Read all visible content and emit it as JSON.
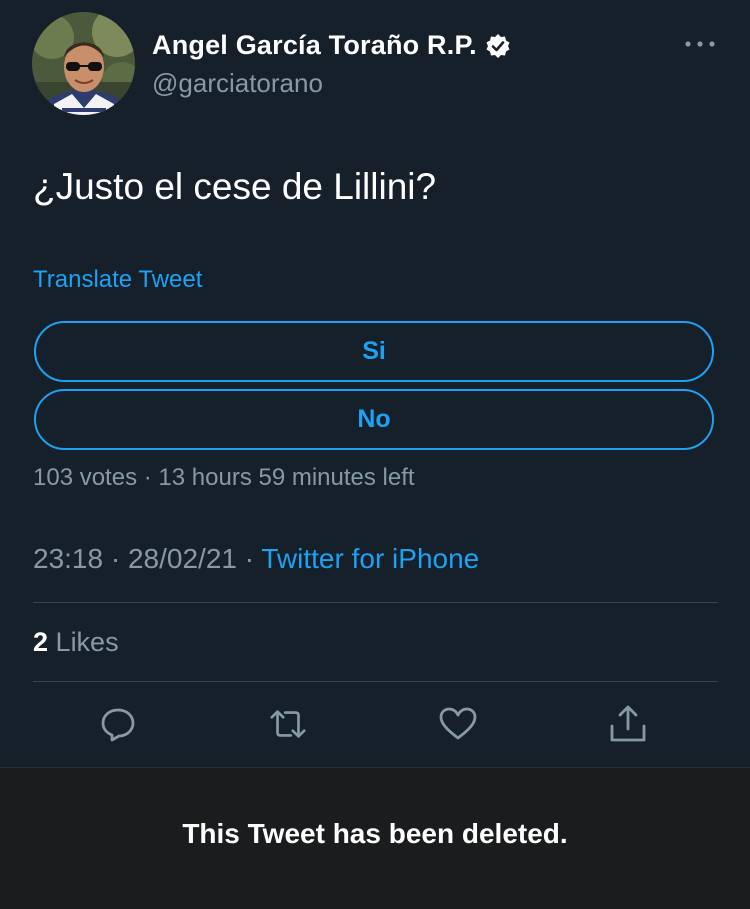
{
  "user": {
    "name": "Angel García Toraño R.P.",
    "handle": "@garciatorano",
    "verified_icon": "verified-badge-icon",
    "avatar": "profile-photo"
  },
  "tweet": {
    "text": "¿Justo el cese de Lillini?",
    "translate_label": "Translate Tweet"
  },
  "poll": {
    "options": [
      {
        "label": "Si"
      },
      {
        "label": "No"
      }
    ],
    "votes": "103 votes",
    "separator": "·",
    "time_left": "13 hours 59 minutes left"
  },
  "meta": {
    "time": "23:18",
    "date": "28/02/21",
    "separator": "·",
    "source": "Twitter for iPhone"
  },
  "stats": {
    "likes_count": "2",
    "likes_label": "Likes"
  },
  "actions": {
    "icons": [
      "reply-icon",
      "retweet-icon",
      "like-icon",
      "share-icon"
    ]
  },
  "notice": {
    "deleted_text": "This Tweet has been deleted."
  },
  "colors": {
    "background": "#15202b",
    "accent": "#1da1f2",
    "secondary_text": "#8899a6",
    "divider": "#38444d",
    "notice_bg": "#1b1c1d"
  }
}
